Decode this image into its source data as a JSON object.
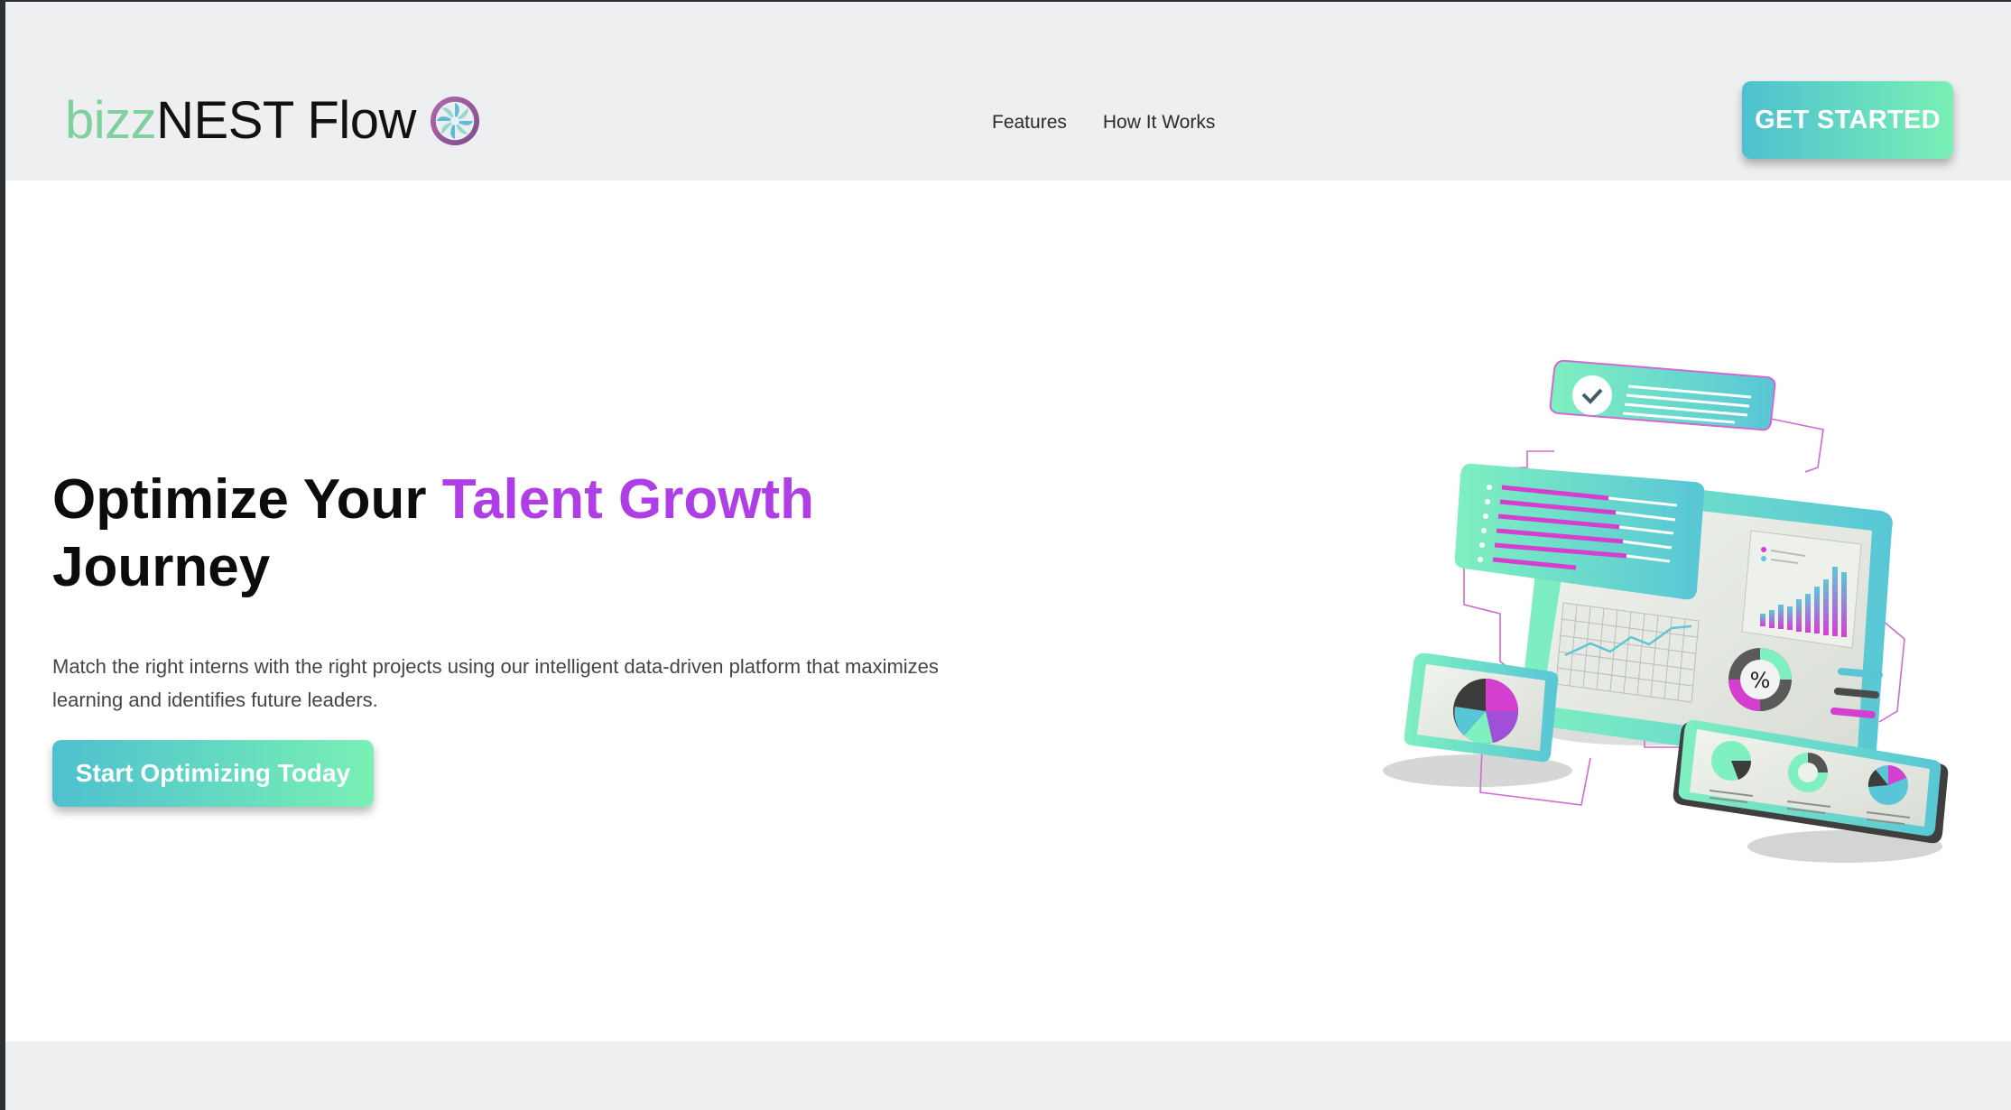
{
  "brand": {
    "name_light": "bizz",
    "name_dark": "NEST Flow",
    "logo_icon": "swirl-logo-icon"
  },
  "nav": {
    "items": [
      {
        "label": "Features"
      },
      {
        "label": "How It Works"
      }
    ]
  },
  "header": {
    "cta_label": "GET STARTED"
  },
  "hero": {
    "title_part1": "Optimize Your ",
    "title_accent": "Talent Growth",
    "title_part2": "Journey",
    "description": "Match the right interns with the right projects using our intelligent data-driven platform that maximizes learning and identifies future leaders.",
    "cta_label": "Start Optimizing Today",
    "illustration_percent": "%"
  },
  "colors": {
    "accent_purple": "#b03ee6",
    "gradient_start": "#4ec0d0",
    "gradient_end": "#79f0b4",
    "logo_green": "#7fcf9f",
    "bar_bg": "#eeeff1"
  }
}
